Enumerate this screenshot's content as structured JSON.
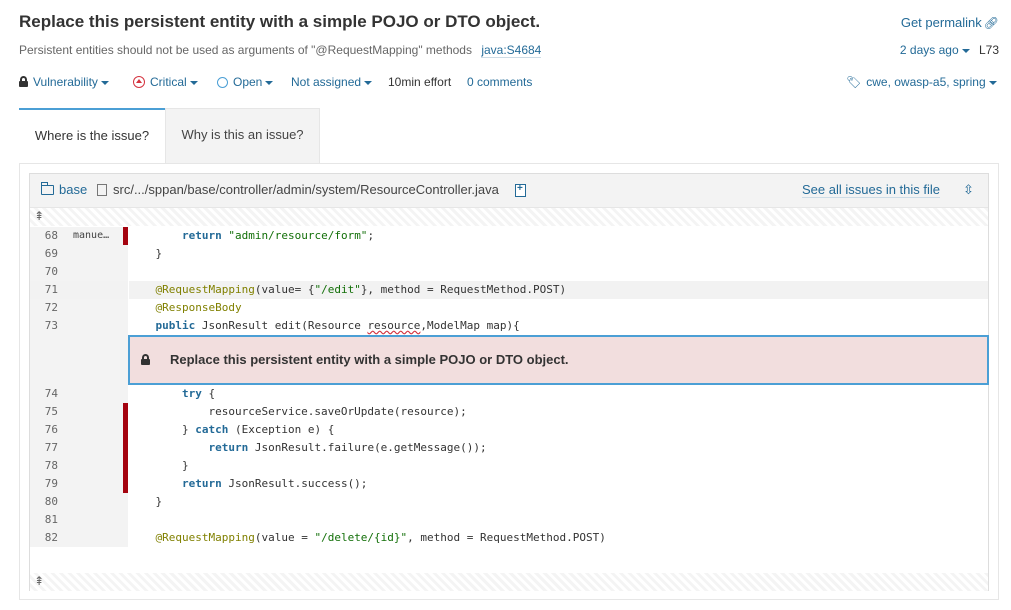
{
  "issue": {
    "title": "Replace this persistent entity with a simple POJO or DTO object.",
    "permalink_label": "Get permalink",
    "subtitle": "Persistent entities should not be used as arguments of \"@RequestMapping\" methods",
    "rule_key": "java:S4684",
    "date": "2 days ago",
    "line": "L73"
  },
  "actions": {
    "type": "Vulnerability",
    "severity": "Critical",
    "status": "Open",
    "assignee": "Not assigned",
    "effort": "10min effort",
    "comments": "0 comments",
    "tags": "cwe, owasp-a5, spring"
  },
  "tabs": [
    {
      "label": "Where is the issue?",
      "active": true
    },
    {
      "label": "Why is this an issue?",
      "active": false
    }
  ],
  "viewer": {
    "project": "base",
    "path": "src/.../sppan/base/controller/admin/system/ResourceController.java",
    "see_all": "See all issues in this file",
    "issue_message": "Replace this persistent entity with a simple POJO or DTO object."
  },
  "code": {
    "scm_author": "manue…",
    "lines": [
      {
        "n": "68",
        "text": "        return \"admin/resource/form\";"
      },
      {
        "n": "69",
        "text": "    }"
      },
      {
        "n": "70",
        "text": ""
      },
      {
        "n": "71",
        "text": "    @RequestMapping(value= {\"/edit\"}, method = RequestMethod.POST)"
      },
      {
        "n": "72",
        "text": "    @ResponseBody"
      },
      {
        "n": "73",
        "text": "    public JsonResult edit(Resource resource,ModelMap map){"
      },
      {
        "n": "74",
        "text": "        try {"
      },
      {
        "n": "75",
        "text": "            resourceService.saveOrUpdate(resource);"
      },
      {
        "n": "76",
        "text": "        } catch (Exception e) {"
      },
      {
        "n": "77",
        "text": "            return JsonResult.failure(e.getMessage());"
      },
      {
        "n": "78",
        "text": "        }"
      },
      {
        "n": "79",
        "text": "        return JsonResult.success();"
      },
      {
        "n": "80",
        "text": "    }"
      },
      {
        "n": "81",
        "text": ""
      },
      {
        "n": "82",
        "text": "    @RequestMapping(value = \"/delete/{id}\", method = RequestMethod.POST)"
      }
    ]
  },
  "colors": {
    "link": "#236a97",
    "active_tab": "#4b9fd5",
    "critical": "#d4333f",
    "duplication": "#a4030f",
    "issue_bg": "#f2dede"
  }
}
